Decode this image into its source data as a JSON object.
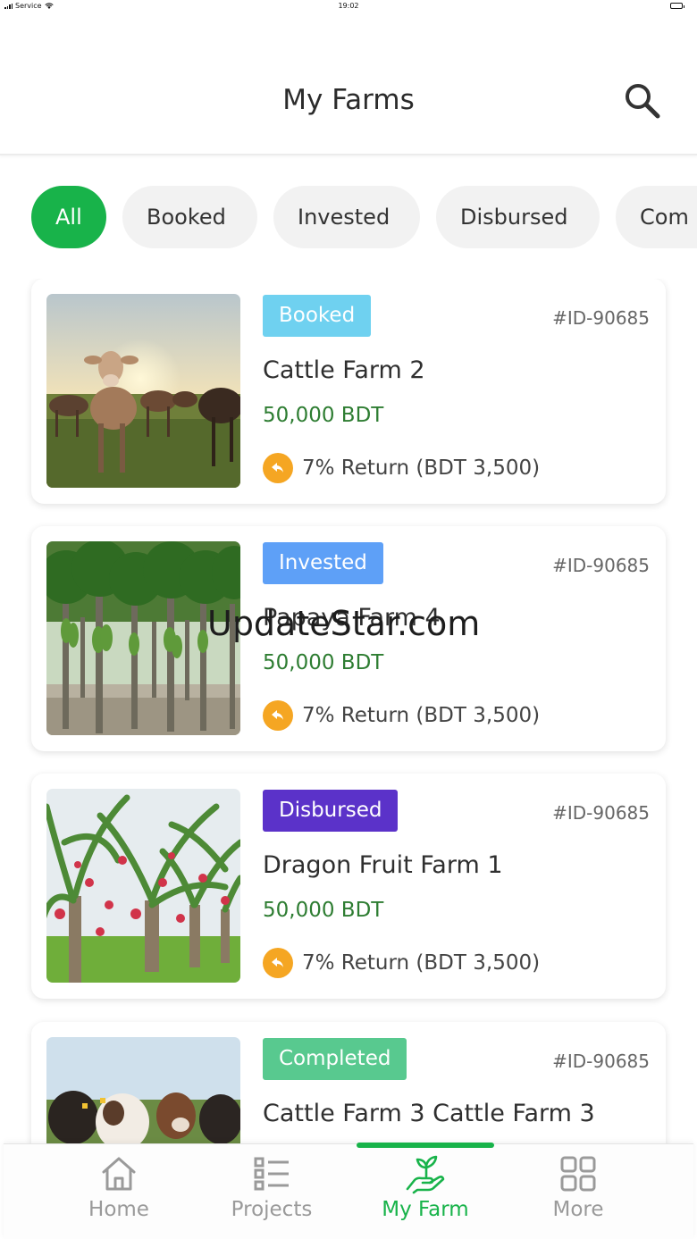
{
  "status": {
    "carrier": "Service",
    "time": "19:02"
  },
  "header": {
    "title": "My Farms",
    "search_icon": "search-icon"
  },
  "filters": [
    {
      "label": "All",
      "active": true
    },
    {
      "label": "Booked",
      "active": false
    },
    {
      "label": "Invested",
      "active": false
    },
    {
      "label": "Disbursed",
      "active": false
    },
    {
      "label": "Com",
      "active": false
    }
  ],
  "colors": {
    "accent": "#18b34a",
    "booked": "#6fd1f0",
    "invested": "#5ea0f7",
    "disbursed": "#5b32c9",
    "completed": "#58c98f",
    "price": "#2e7d32",
    "return_icon": "#f5a623"
  },
  "farms": [
    {
      "status": "Booked",
      "id": "#ID-90685",
      "name": "Cattle Farm 2",
      "price": "50,000 BDT",
      "return": "7% Return (BDT 3,500)",
      "image": "cattle-herd-sunset"
    },
    {
      "status": "Invested",
      "id": "#ID-90685",
      "name": "Papaya Farm 4",
      "price": "50,000 BDT",
      "return": "7% Return (BDT 3,500)",
      "image": "papaya-trees"
    },
    {
      "status": "Disbursed",
      "id": "#ID-90685",
      "name": "Dragon Fruit Farm 1",
      "price": "50,000 BDT",
      "return": "7% Return (BDT 3,500)",
      "image": "dragon-fruit-plants"
    },
    {
      "status": "Completed",
      "id": "#ID-90685",
      "name": "Cattle Farm 3 Cattle Farm 3",
      "price": "",
      "return": "",
      "image": "dairy-cows"
    }
  ],
  "watermark": "UpdateStar.com",
  "nav": [
    {
      "label": "Home",
      "icon": "home-icon",
      "active": false
    },
    {
      "label": "Projects",
      "icon": "list-icon",
      "active": false
    },
    {
      "label": "My Farm",
      "icon": "plant-hand-icon",
      "active": true
    },
    {
      "label": "More",
      "icon": "grid-icon",
      "active": false
    }
  ]
}
